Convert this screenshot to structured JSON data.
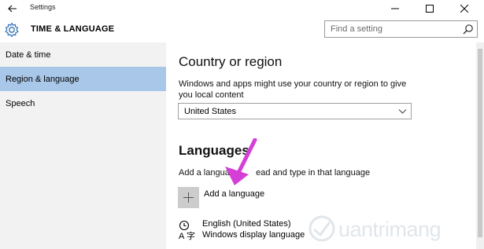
{
  "window": {
    "title": "Settings",
    "back_icon": "back-arrow-icon",
    "controls": [
      "minimize-icon",
      "maximize-icon",
      "close-icon"
    ]
  },
  "header": {
    "title": "TIME & LANGUAGE",
    "icon": "gear-icon",
    "search_placeholder": "Find a setting"
  },
  "sidebar": {
    "items": [
      {
        "label": "Date & time",
        "active": false
      },
      {
        "label": "Region & language",
        "active": true
      },
      {
        "label": "Speech",
        "active": false
      }
    ]
  },
  "main": {
    "country": {
      "heading": "Country or region",
      "description": "Windows and apps might use your country or region to give you local content",
      "selected": "United States"
    },
    "languages": {
      "heading": "Languages",
      "description_start": "Add a language",
      "description_end": "ead and type in that language",
      "add_label": "Add a language",
      "items": [
        {
          "name": "English (United States)",
          "subtitle": "Windows display language"
        }
      ]
    }
  },
  "annotation": {
    "arrow_color": "#d63fd6"
  },
  "watermark": {
    "text": "uantrimang"
  },
  "colors": {
    "sidebar_bg": "#f2f2f2",
    "active_item": "#a9c7e8",
    "plus_tile": "#cccccc"
  }
}
